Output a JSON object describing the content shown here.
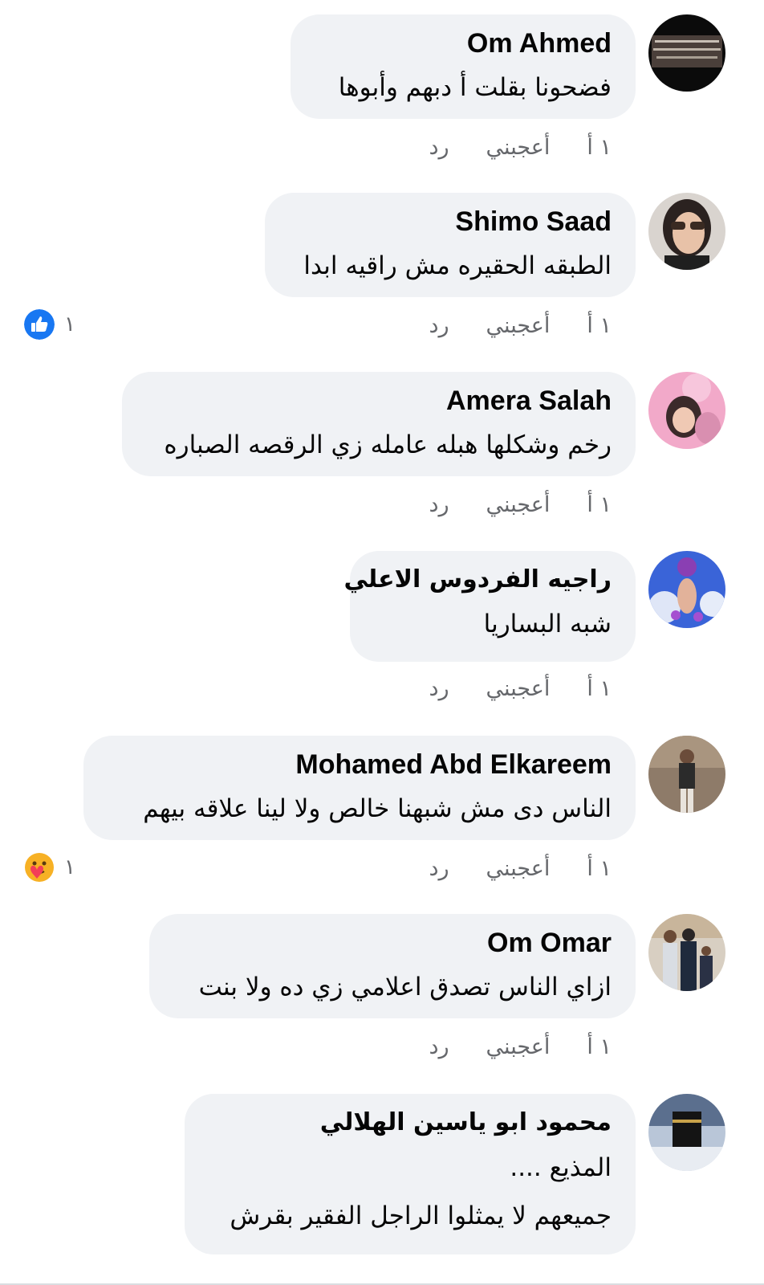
{
  "colors": {
    "bubble_bg": "#f0f2f5",
    "text": "#050505",
    "meta": "#65676b",
    "like_blue": "#1877f2"
  },
  "actions": {
    "time": "١ أ",
    "like": "أعجبني",
    "reply": "رد"
  },
  "comments": [
    {
      "author": "Om Ahmed",
      "avatar_icon": "avatar-dark-calligraphy",
      "lines": [
        "فضحونا بقلت أ دبهم وأبوها"
      ],
      "reaction": null
    },
    {
      "author": "Shimo Saad",
      "avatar_icon": "avatar-woman-sunglasses",
      "lines": [
        "الطبقه الحقيره مش راقيه ابدا"
      ],
      "reaction": {
        "icon": "like-icon",
        "count": "١"
      }
    },
    {
      "author": "Amera Salah",
      "avatar_icon": "avatar-pink-mother-child",
      "lines": [
        "رخم وشكلها هبله عامله زي الرقصه الصباره"
      ],
      "reaction": null
    },
    {
      "author": "راجيه الفردوس الاعلي",
      "avatar_icon": "avatar-purple-rose-hand",
      "lines": [
        "شبه البساريا"
      ],
      "reaction": null
    },
    {
      "author": "Mohamed Abd Elkareem",
      "avatar_icon": "avatar-man-standing",
      "lines": [
        "الناس دى مش شبهنا خالص ولا لينا علاقه بيهم"
      ],
      "reaction": {
        "icon": "care-icon",
        "count": "١"
      }
    },
    {
      "author": "Om Omar",
      "avatar_icon": "avatar-family-photo",
      "lines": [
        "ازاي الناس تصدق اعلامي زي ده ولا بنت"
      ],
      "reaction": null
    },
    {
      "author": "محمود ابو ياسين الهلالي",
      "avatar_icon": "avatar-kaaba",
      "lines": [
        "المذيع ....",
        "جميعهم لا يمثلوا الراجل الفقير بقرش"
      ],
      "reaction": null
    }
  ]
}
